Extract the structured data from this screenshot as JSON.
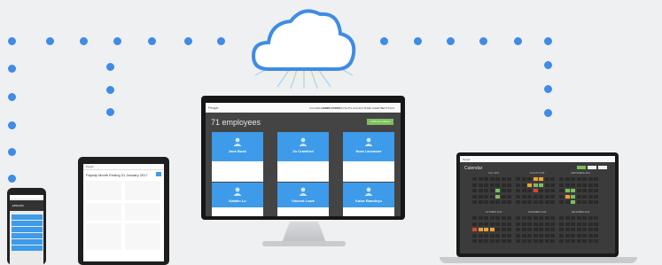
{
  "monitor": {
    "brand": "Peoplr",
    "nav_items": [
      "CALENDAR",
      "EMPLOYEES",
      "PAYSLIPS",
      "HOLIDAYS",
      "TIME SHEETS",
      "SETTINGS"
    ],
    "page_title": "71 employees",
    "add_button": "+ Add new employee",
    "employees": [
      {
        "name": "Jack Bush"
      },
      {
        "name": "Zo Crawford"
      },
      {
        "name": "Nora Lancaster"
      },
      {
        "name": "Katalin Lo"
      },
      {
        "name": "Vincent Lowe"
      },
      {
        "name": "Kaise Ramdeyu"
      }
    ]
  },
  "tablet": {
    "brand": "Peoplr",
    "title": "Payslip Month Ending 31 January 2017"
  },
  "phone": {
    "amount": "£350,000"
  },
  "laptop": {
    "brand": "Peoplr",
    "title": "Calendar",
    "months": [
      "JULY 2016",
      "AUGUST 2016",
      "SEPTEMBER 2016",
      "OCTOBER 2016",
      "NOVEMBER 2016",
      "DECEMBER 2016"
    ]
  },
  "colors": {
    "accent": "#3d9be9",
    "dots": "#3f8be6",
    "green": "#7bbf5b",
    "orange": "#f0a030",
    "red": "#d9433c"
  },
  "icons": [
    "cloud-icon",
    "user-avatar-icon"
  ]
}
